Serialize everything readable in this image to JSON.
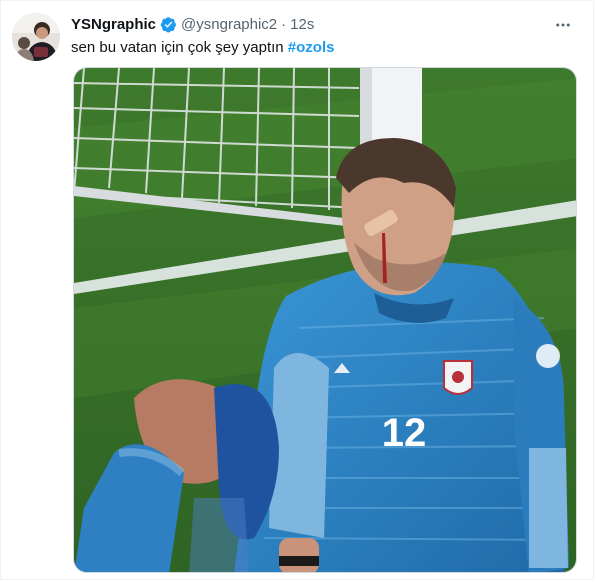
{
  "tweet": {
    "display_name": "YSNgraphic",
    "handle": "@ysngraphic2",
    "separator": "·",
    "time": "12s",
    "text_prefix": "sen bu vatan için çok şey yaptın ",
    "hashtag": "#ozols",
    "jersey_number": "12"
  },
  "colors": {
    "link": "#1d9bf0",
    "secondary_text": "#536471",
    "pitch": "#3f7a2f",
    "kit": "#2a7fc0"
  },
  "icons": {
    "verified": "verified-badge",
    "more": "more-options"
  }
}
